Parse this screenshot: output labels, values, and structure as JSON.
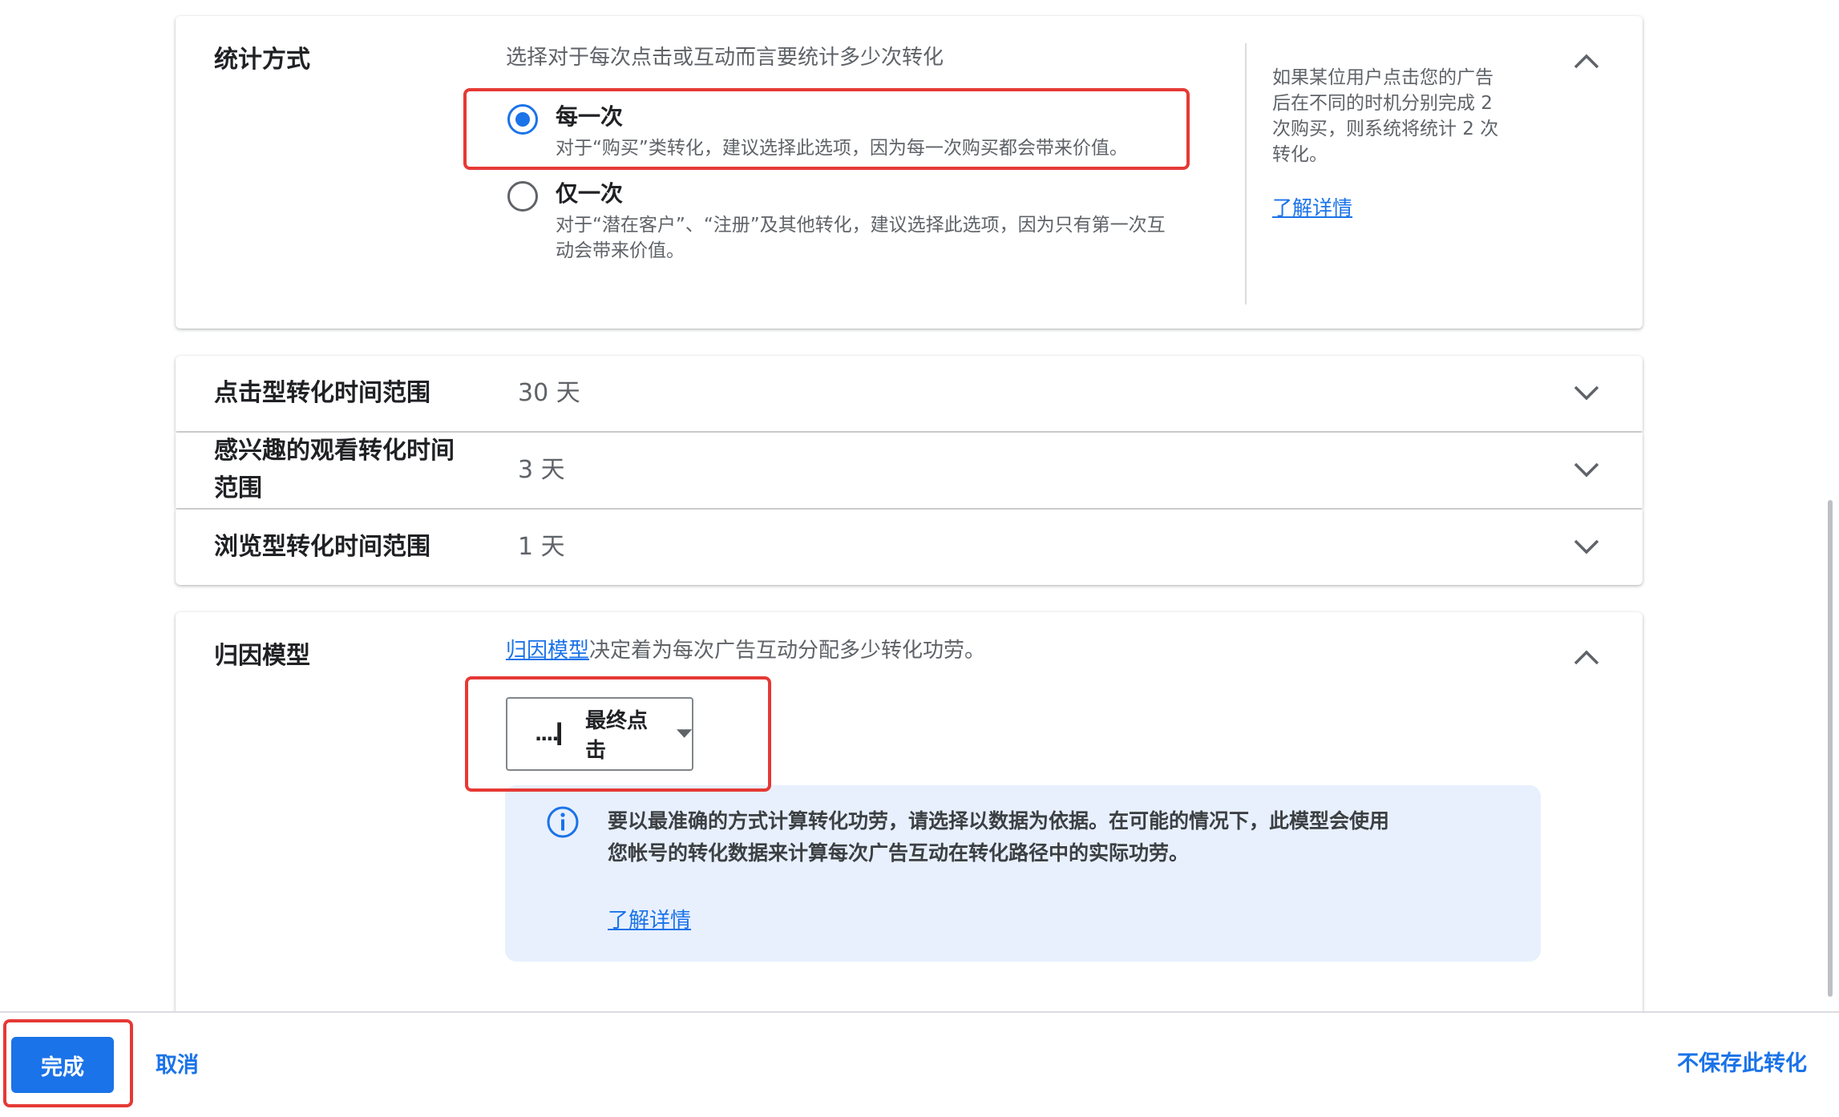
{
  "counting": {
    "title": "统计方式",
    "description": "选择对于每次点击或互动而言要统计多少次转化",
    "options": [
      {
        "label": "每一次",
        "sub": "对于“购买”类转化，建议选择此选项，因为每一次购买都会带来价值。",
        "selected": true
      },
      {
        "label": "仅一次",
        "sub_line1": "对于“潜在客户”、“注册”及其他转化，建议选择此选项，因为只有第一次互",
        "sub_line2": "动会带来价值。",
        "selected": false
      }
    ],
    "help_line1": "如果某位用户点击您的广告",
    "help_line2": "后在不同的时机分别完成 2",
    "help_line3": "次购买，则系统将统计 2 次",
    "help_line4": "转化。",
    "help_link": "了解详情"
  },
  "windows": [
    {
      "title": "点击型转化时间范围",
      "value": "30 天"
    },
    {
      "title_line1": "感兴趣的观看转化时间",
      "title_line2": "范围",
      "value": "3 天"
    },
    {
      "title": "浏览型转化时间范围",
      "value": "1 天"
    }
  ],
  "attribution": {
    "title": "归因模型",
    "desc_link": "归因模型",
    "desc_rest": "决定着为每次广告互动分配多少转化功劳。",
    "dropdown_icon": "....▎",
    "dropdown_value": "最终点击",
    "info_line1": "要以最准确的方式计算转化功劳，请选择以数据为依据。在可能的情况下，此模型会使用",
    "info_line2": "您帐号的转化数据来计算每次广告互动在转化路径中的实际功劳。",
    "info_link": "了解详情"
  },
  "footer": {
    "done": "完成",
    "cancel": "取消",
    "discard": "不保存此转化"
  },
  "colors": {
    "accent": "#1a73e8",
    "highlight": "#e53935",
    "info_bg": "#e8f0fe"
  }
}
